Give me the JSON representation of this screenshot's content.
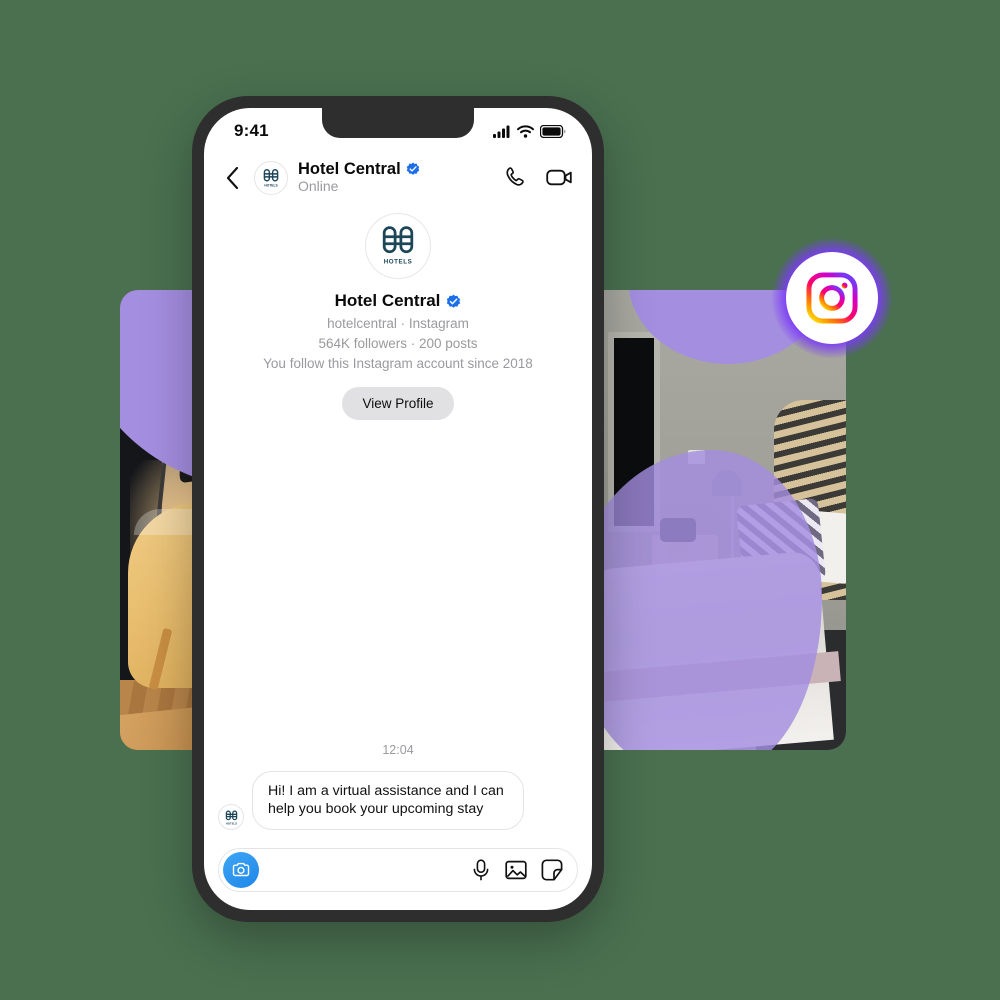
{
  "theme": {
    "background": "#4a7050",
    "phone_frame": "#2e2e2e",
    "accent_blue": "#1e86e8",
    "verified_blue": "#1d6fe8",
    "purple_overlay": "#a48ee0",
    "instagram_glow": "#7b3bf5",
    "muted_text": "#9a9a9e",
    "button_bg": "#e1e1e4"
  },
  "status_bar": {
    "time": "9:41",
    "icons": [
      "cellular-signal-icon",
      "wifi-icon",
      "battery-icon"
    ]
  },
  "chat_header": {
    "back_icon": "chevron-left-icon",
    "avatar_icon": "hotels-logo-icon",
    "name": "Hotel Central",
    "verified_icon": "verified-badge-icon",
    "status": "Online",
    "call_icon": "phone-call-icon",
    "video_icon": "video-camera-icon"
  },
  "profile": {
    "avatar_icon": "hotels-logo-icon",
    "avatar_label": "HOTELS",
    "name": "Hotel Central",
    "verified_icon": "verified-badge-icon",
    "handle_line": "hotelcentral · Instagram",
    "stats_line": "564K followers · 200 posts",
    "follow_line": "You follow this Instagram account since 2018",
    "view_profile_label": "View Profile"
  },
  "conversation": {
    "timestamp": "12:04",
    "messages": [
      {
        "sender_avatar_icon": "hotels-logo-icon",
        "text": "Hi! I am a virtual assistance and I can help you book your upcoming stay"
      }
    ]
  },
  "composer": {
    "camera_icon": "camera-icon",
    "placeholder": "",
    "icons": [
      "microphone-icon",
      "photo-gallery-icon",
      "sticker-icon"
    ]
  },
  "decorations": {
    "instagram_badge_icon": "instagram-logo-icon",
    "left_photo_alt": "hotel-room-chair-lamp-photo",
    "right_photo_alt": "hotel-bedroom-bed-photo"
  }
}
